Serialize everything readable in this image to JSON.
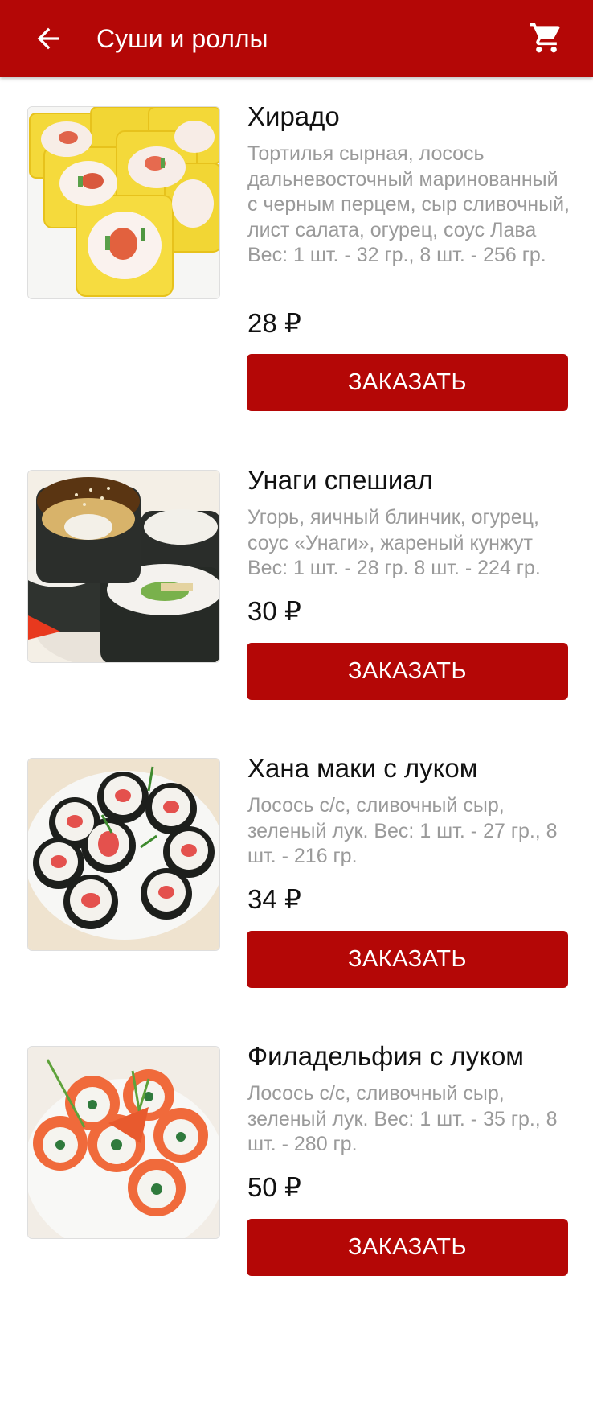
{
  "header": {
    "title": "Суши и роллы",
    "back_icon": "arrow-left-icon",
    "cart_icon": "shopping-cart-icon",
    "color": "#b40706"
  },
  "products": [
    {
      "name": "Хирадо",
      "description": "Тортилья сырная, лосось дальневосточный маринованный с черным перцем, сыр сливочный, лист салата, огурец, соус  Лава  Вес: 1 шт. - 32 гр., 8 шт. - 256 гр.",
      "price": "28 ₽",
      "button": "ЗАКАЗАТЬ"
    },
    {
      "name": "Унаги спешиал",
      "description": "Угорь, яичный блинчик, огурец, соус «Унаги», жареный кунжут Вес: 1 шт. - 28 гр. 8 шт. - 224 гр.",
      "price": "30 ₽",
      "button": "ЗАКАЗАТЬ"
    },
    {
      "name": "Хана маки с луком",
      "description": "Лосось с/с, сливочный сыр, зеленый лук. Вес: 1 шт. - 27 гр., 8 шт. - 216 гр.",
      "price": "34 ₽",
      "button": "ЗАКАЗАТЬ"
    },
    {
      "name": "Филадельфия с луком",
      "description": "Лосось с/с, сливочный сыр, зеленый лук. Вес: 1 шт. - 35 гр., 8 шт. - 280 гр.",
      "price": "50 ₽",
      "button": "ЗАКАЗАТЬ"
    }
  ]
}
